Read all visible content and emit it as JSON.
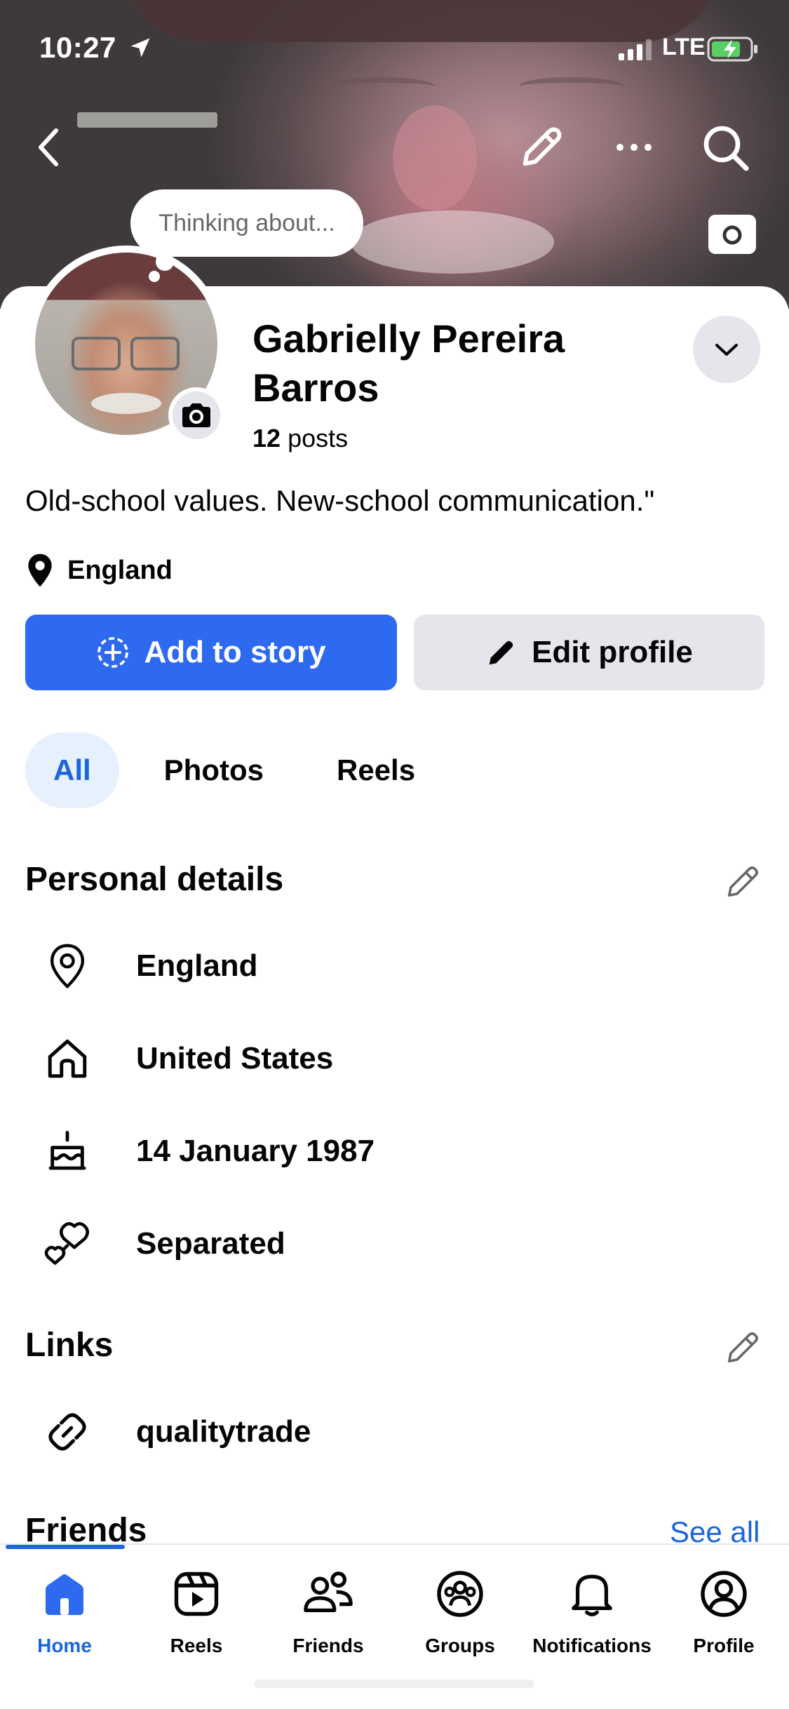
{
  "status_bar": {
    "time": "10:27",
    "network": "LTE"
  },
  "cover": {
    "thought_placeholder": "Thinking about..."
  },
  "profile": {
    "name": "Gabrielly Pereira Barros",
    "posts_count": "12",
    "posts_label": "posts",
    "bio": "Old-school values. New-school communication.\"",
    "location": "England"
  },
  "actions": {
    "add_story_label": "Add to story",
    "edit_profile_label": "Edit profile"
  },
  "tabs": [
    {
      "label": "All",
      "active": true
    },
    {
      "label": "Photos",
      "active": false
    },
    {
      "label": "Reels",
      "active": false
    }
  ],
  "personal_details": {
    "title": "Personal details",
    "items": [
      {
        "icon": "location-pin-icon",
        "text": "England"
      },
      {
        "icon": "home-icon",
        "text": "United States"
      },
      {
        "icon": "birthday-cake-icon",
        "text": "14 January 1987"
      },
      {
        "icon": "hearts-icon",
        "text": "Separated"
      }
    ]
  },
  "links": {
    "title": "Links",
    "items": [
      {
        "icon": "link-icon",
        "text": "qualitytrade"
      }
    ]
  },
  "friends": {
    "title": "Friends",
    "see_all": "See all"
  },
  "bottom_nav": [
    {
      "label": "Home",
      "icon": "home-icon",
      "active": true
    },
    {
      "label": "Reels",
      "icon": "reels-icon",
      "active": false
    },
    {
      "label": "Friends",
      "icon": "friends-icon",
      "active": false
    },
    {
      "label": "Groups",
      "icon": "groups-icon",
      "active": false
    },
    {
      "label": "Notifications",
      "icon": "bell-icon",
      "active": false
    },
    {
      "label": "Profile",
      "icon": "profile-icon",
      "active": false
    }
  ],
  "colors": {
    "accent": "#2d6af0",
    "link": "#1b66d8",
    "button_gray": "#e4e6eb",
    "active_tab_bg": "#e7f0fd"
  }
}
